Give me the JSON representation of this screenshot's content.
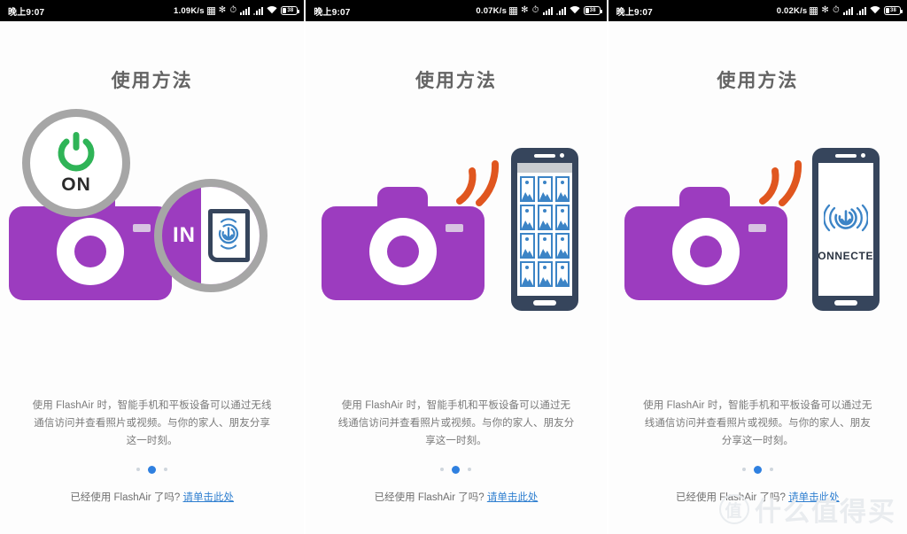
{
  "statusbar": {
    "clock": "晚上9:07",
    "net_speeds": [
      "1.09K/s",
      "0.07K/s",
      "0.02K/s"
    ],
    "icons": [
      "data-grid-icon",
      "bluetooth-icon",
      "alarm-clock-icon",
      "signal-bars-icon",
      "signal-bars-2-icon",
      "wifi-icon",
      "battery-icon"
    ],
    "bluetooth_glyph": "✻",
    "alarm_glyph": "⏱",
    "battery_level": "38"
  },
  "panels": [
    {
      "title": "使用方法",
      "description": "使用 FlashAir 时，智能手机和平板设备可以通过无线通信访问并查看照片或视频。与你的家人、朋友分享这一时刻。",
      "power_label": "ON",
      "card_label": "IN",
      "footer_question": "已经使用 FlashAir 了吗?",
      "footer_link": "请单击此处",
      "dots": {
        "count": 3,
        "active_index": 1
      }
    },
    {
      "title": "使用方法",
      "description": "使用 FlashAir 时，智能手机和平板设备可以通过无线通信访问并查看照片或视频。与你的家人、朋友分享这一时刻。",
      "footer_question": "已经使用 FlashAir 了吗?",
      "footer_link": "请单击此处",
      "dots": {
        "count": 3,
        "active_index": 1
      },
      "thumbnail_count": 12
    },
    {
      "title": "使用方法",
      "description": "使用 FlashAir 时，智能手机和平板设备可以通过无线通信访问并查看照片或视频。与你的家人、朋友分享这一时刻。",
      "connected_label": "CONNECTED",
      "footer_question": "已经使用 FlashAir 了吗?",
      "footer_link": "请单击此处",
      "dots": {
        "count": 3,
        "active_index": 1
      }
    }
  ],
  "watermark": {
    "mark": "值",
    "text": "什么值得买"
  },
  "colors": {
    "camera_purple": "#9c3cbf",
    "phone_navy": "#36455c",
    "wifi_orange": "#e0561f",
    "power_green": "#2fb457",
    "link_blue": "#2f7fd0",
    "accent_dot": "#2f80e0",
    "thumb_blue": "#3c84c6",
    "ring_gray": "#a6a6a6"
  }
}
